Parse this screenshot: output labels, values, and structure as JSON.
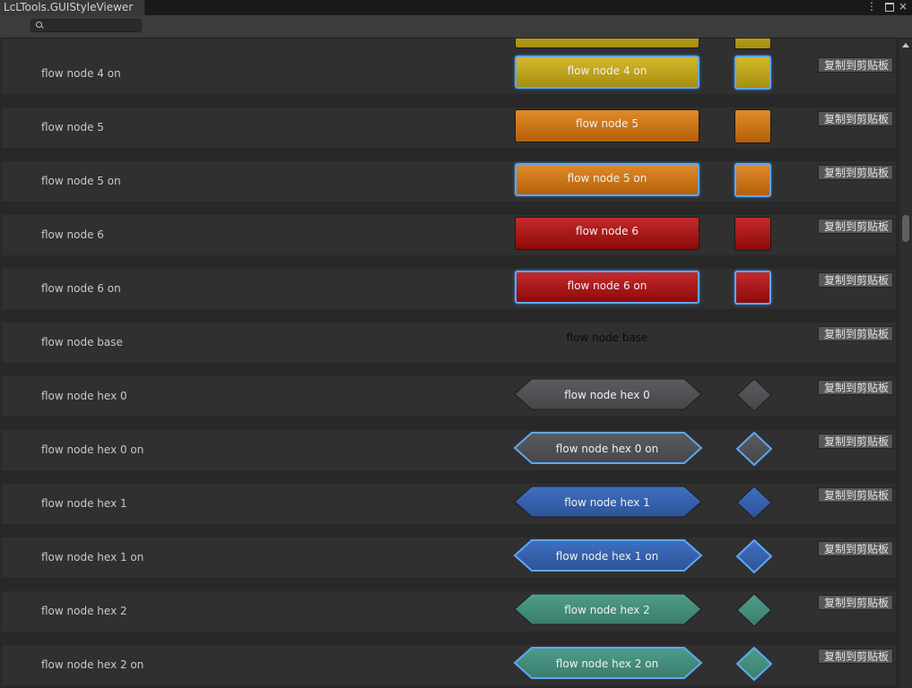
{
  "window": {
    "tab_title": "LcLTools.GUIStyleViewer",
    "menu_glyph": "⋮",
    "close_glyph": "×"
  },
  "toolbar": {
    "search_value": "",
    "search_placeholder": ""
  },
  "copy_label": "复制到剪贴板",
  "top_partial": {
    "style": "yellow"
  },
  "rows": [
    {
      "name": "flow node 4 on",
      "preview": "flow node 4 on",
      "style": "yellow",
      "on": true,
      "shape": "rect"
    },
    {
      "name": "flow node 5",
      "preview": "flow node 5",
      "style": "orange",
      "on": false,
      "shape": "rect"
    },
    {
      "name": "flow node 5 on",
      "preview": "flow node 5 on",
      "style": "orange",
      "on": true,
      "shape": "rect"
    },
    {
      "name": "flow node 6",
      "preview": "flow node 6",
      "style": "red",
      "on": false,
      "shape": "rect"
    },
    {
      "name": "flow node 6 on",
      "preview": "flow node 6 on",
      "style": "red",
      "on": true,
      "shape": "rect"
    },
    {
      "name": "flow node base",
      "preview": "flow node base",
      "style": "none",
      "on": false,
      "shape": "text"
    },
    {
      "name": "flow node hex 0",
      "preview": "flow node hex 0",
      "style": "gray",
      "on": false,
      "shape": "hex"
    },
    {
      "name": "flow node hex 0 on",
      "preview": "flow node hex 0 on",
      "style": "gray",
      "on": true,
      "shape": "hex"
    },
    {
      "name": "flow node hex 1",
      "preview": "flow node hex 1",
      "style": "blue",
      "on": false,
      "shape": "hex"
    },
    {
      "name": "flow node hex 1 on",
      "preview": "flow node hex 1 on",
      "style": "blue",
      "on": true,
      "shape": "hex"
    },
    {
      "name": "flow node hex 2",
      "preview": "flow node hex 2",
      "style": "teal",
      "on": false,
      "shape": "hex"
    },
    {
      "name": "flow node hex 2 on",
      "preview": "flow node hex 2 on",
      "style": "teal",
      "on": true,
      "shape": "hex"
    }
  ],
  "colors": {
    "gray": [
      "#5a5c60",
      "#45474a"
    ],
    "blue": [
      "#3f70c2",
      "#2d5397"
    ],
    "teal": [
      "#4e9e8c",
      "#3b7c6c"
    ],
    "glow": "#5ea7f5"
  }
}
